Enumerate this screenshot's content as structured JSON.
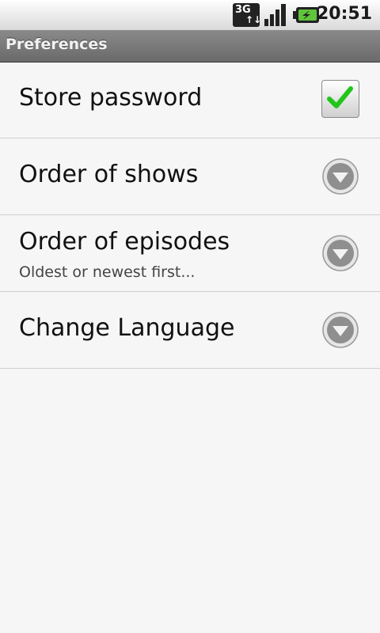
{
  "status_bar": {
    "network_label": "3G",
    "network_activity": "↑↓",
    "signal_icon": "signal-bars-icon",
    "battery_icon": "battery-charging-icon",
    "time": "20:51"
  },
  "title_bar": {
    "title": "Preferences"
  },
  "preferences": [
    {
      "label": "Store password",
      "widget": "checkbox",
      "checked": true
    },
    {
      "label": "Order of shows",
      "widget": "dropdown"
    },
    {
      "label": "Order of episodes",
      "summary": "Oldest or newest first...",
      "widget": "dropdown"
    },
    {
      "label": "Change Language",
      "widget": "dropdown"
    }
  ],
  "colors": {
    "title_bar": "#7a7a7a",
    "check_mark": "#22c51a",
    "background": "#f6f6f6"
  }
}
